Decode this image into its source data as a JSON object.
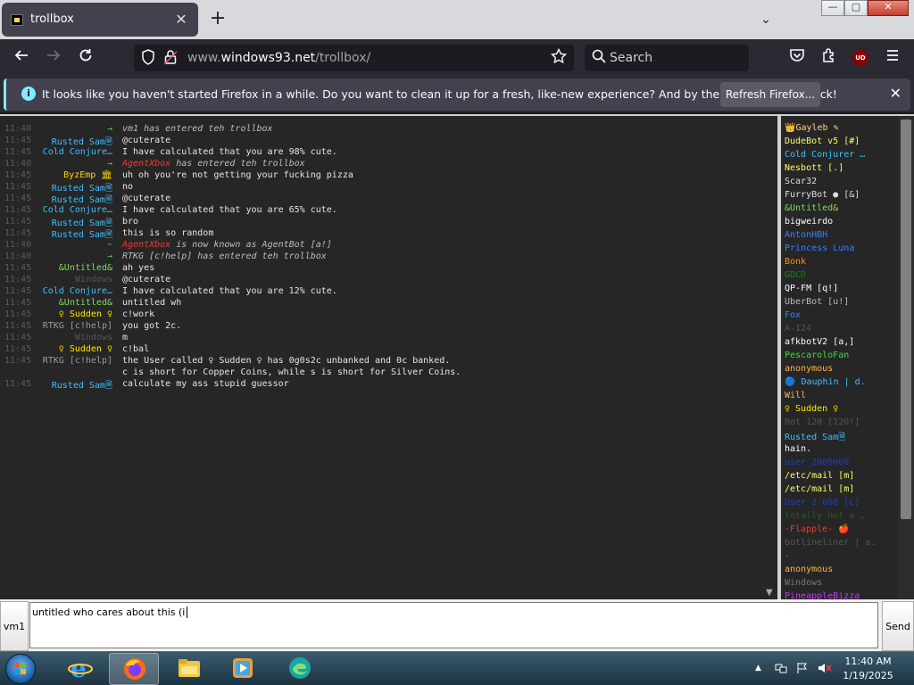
{
  "browser": {
    "tab_title": "trollbox",
    "tab_close": "✕",
    "new_tab": "+",
    "tab_list": "⌄",
    "window_controls": {
      "minimize": "—",
      "maximize": "▢",
      "close": "✕"
    },
    "url_host_prefix": "www.",
    "url_host": "windows93.net",
    "url_path": "/trollbox/",
    "search_placeholder": "Search",
    "ublock_label": "UD",
    "nav_icons": [
      "back-icon",
      "forward-icon",
      "reload-icon",
      "shield-icon",
      "lock-icon",
      "bookmark-star-icon",
      "search-icon",
      "pocket-icon",
      "extensions-icon",
      "menu-icon"
    ]
  },
  "notification": {
    "text": "It looks like you haven't started Firefox in a while. Do you want to clean it up for a fresh, like-new experience? And by the way, welcome back!",
    "button": "Refresh Firefox...",
    "close": "✕",
    "accent": "#80ebff"
  },
  "chat": {
    "messages": [
      {
        "time": "11:40",
        "nick": "→",
        "nick_color": "#3ddc3d",
        "text": "vm1 has entered teh trollbox",
        "text_color": "#bdbdbd",
        "italic": true
      },
      {
        "time": "11:45",
        "nick": "Rusted Sam🗎",
        "nick_color": "#3fbfff",
        "text": "@cuterate",
        "text_color": "#e6e6e6"
      },
      {
        "time": "11:45",
        "nick": "Cold Conjure…",
        "nick_color": "#3fbfff",
        "text": "I have calculated that you are 98% cute.",
        "text_color": "#e6e6e6"
      },
      {
        "time": "11:40",
        "nick": "→",
        "nick_color": "#3ddc3d",
        "text": "AgentXbox has entered teh trollbox",
        "text_color": "#bdbdbd",
        "italic": true,
        "highlight": "AgentXbox",
        "highlight_color": "#ff3333"
      },
      {
        "time": "11:45",
        "nick": "ByzEmp 🏛",
        "nick_color": "#ffd700",
        "text": "uh oh you're not getting your fucking pizza",
        "text_color": "#e6e6e6"
      },
      {
        "time": "11:45",
        "nick": "Rusted Sam🗎",
        "nick_color": "#3fbfff",
        "text": "no",
        "text_color": "#e6e6e6"
      },
      {
        "time": "11:45",
        "nick": "Rusted Sam🗎",
        "nick_color": "#3fbfff",
        "text": "@cuterate",
        "text_color": "#e6e6e6"
      },
      {
        "time": "11:45",
        "nick": "Cold Conjure…",
        "nick_color": "#3fbfff",
        "text": "I have calculated that you are 65% cute.",
        "text_color": "#e6e6e6"
      },
      {
        "time": "11:45",
        "nick": "Rusted Sam🗎",
        "nick_color": "#3fbfff",
        "text": "bro",
        "text_color": "#e6e6e6"
      },
      {
        "time": "11:45",
        "nick": "Rusted Sam🗎",
        "nick_color": "#3fbfff",
        "text": "this is so random",
        "text_color": "#e6e6e6"
      },
      {
        "time": "11:40",
        "nick": "~",
        "nick_color": "#3ddc3d",
        "text": "AgentXbox is now known as AgentBot [a!]",
        "text_color": "#bdbdbd",
        "italic": true,
        "highlight": "AgentXbox",
        "highlight_color": "#ff3333"
      },
      {
        "time": "11:40",
        "nick": "→",
        "nick_color": "#3ddc3d",
        "text": "RTKG [c!help] has entered teh trollbox",
        "text_color": "#bdbdbd",
        "italic": true
      },
      {
        "time": "11:45",
        "nick": "&Untitled&",
        "nick_color": "#7fdc5a",
        "text": "ah yes",
        "text_color": "#e6e6e6"
      },
      {
        "time": "11:45",
        "nick": "Windows",
        "nick_color": "#555555",
        "text": "@cuterate",
        "text_color": "#e6e6e6"
      },
      {
        "time": "11:45",
        "nick": "Cold Conjure…",
        "nick_color": "#3fbfff",
        "text": "I have calculated that you are 12% cute.",
        "text_color": "#e6e6e6"
      },
      {
        "time": "11:45",
        "nick": "&Untitled&",
        "nick_color": "#7fdc5a",
        "text": "untitled wh",
        "text_color": "#e6e6e6"
      },
      {
        "time": "11:45",
        "nick": "♀ Sudden ♀",
        "nick_color": "#ffe600",
        "text": "c!work",
        "text_color": "#e6e6e6"
      },
      {
        "time": "11:45",
        "nick": "RTKG [c!help]",
        "nick_color": "#9a9a9a",
        "text": "you got 2c.",
        "text_color": "#e6e6e6"
      },
      {
        "time": "11:45",
        "nick": "Windows",
        "nick_color": "#555555",
        "text": "m",
        "text_color": "#e6e6e6"
      },
      {
        "time": "11:45",
        "nick": "♀ Sudden ♀",
        "nick_color": "#ffe600",
        "text": "c!bal",
        "text_color": "#e6e6e6"
      },
      {
        "time": "11:45",
        "nick": "RTKG [c!help]",
        "nick_color": "#9a9a9a",
        "text": "the User called ♀ Sudden ♀ has 0g0s2c unbanked and 0c banked.",
        "text_color": "#e6e6e6"
      },
      {
        "time": "",
        "nick": "",
        "nick_color": "#9a9a9a",
        "text": "c is short for Copper Coins, while s is short for Silver Coins.",
        "text_color": "#e6e6e6"
      },
      {
        "time": "11:45",
        "nick": "Rusted Sam🗎",
        "nick_color": "#3fbfff",
        "text": "calculate my ass stupid guessor",
        "text_color": "#e6e6e6"
      }
    ],
    "time_color": "#5a5a5a"
  },
  "users": [
    {
      "name": "👑Gayleb ✎",
      "color": "#ffd27f"
    },
    {
      "name": "DudeBot v5 [#]",
      "color": "#ffff66"
    },
    {
      "name": "Cold Conjurer …",
      "color": "#3fbfff"
    },
    {
      "name": "Nesbott [.]",
      "color": "#ffff66"
    },
    {
      "name": "Scar32",
      "color": "#dddddd"
    },
    {
      "name": "FurryBot ● [&]",
      "color": "#dddddd"
    },
    {
      "name": "&Untitled&",
      "color": "#7fdc5a"
    },
    {
      "name": "bigweirdo",
      "color": "#ffffff"
    },
    {
      "name": "AntonHBH",
      "color": "#3a7fff"
    },
    {
      "name": "Princess Luna",
      "color": "#3a7fff"
    },
    {
      "name": "Bonk",
      "color": "#ff8c1a"
    },
    {
      "name": "GDCD",
      "color": "#1f7a1f"
    },
    {
      "name": "QP-FM [q!]",
      "color": "#ffffff"
    },
    {
      "name": "UberBot [u!]",
      "color": "#bbbbbb"
    },
    {
      "name": "Fox",
      "color": "#3a7fff"
    },
    {
      "name": "A-124",
      "color": "#555555"
    },
    {
      "name": "afkbotV2 [a,]",
      "color": "#ffffff"
    },
    {
      "name": "PescaroloFan",
      "color": "#3ddc3d"
    },
    {
      "name": "anonymous",
      "color": "#ffb347"
    },
    {
      "name": "🔵 Dauphin | d.",
      "color": "#3fbfff"
    },
    {
      "name": "Will",
      "color": "#ffb347"
    },
    {
      "name": "♀ Sudden ♀",
      "color": "#ffe600"
    },
    {
      "name": "Bot 120 [120!]",
      "color": "#555555"
    },
    {
      "name": "Rusted Sam🗎",
      "color": "#3fbfff"
    },
    {
      "name": "hain.",
      "color": "#ffffff"
    },
    {
      "name": "user_2000000",
      "color": "#1f3fbf"
    },
    {
      "name": "/etc/mail [m]",
      "color": "#ffff66"
    },
    {
      "name": "/etc/mail [m]",
      "color": "#ffff66"
    },
    {
      "name": "User 2.000 [c]",
      "color": "#1f3fbf"
    },
    {
      "name": "totally not a …",
      "color": "#1f5f1f"
    },
    {
      "name": "-Flapple- 🍎",
      "color": "#ff3333"
    },
    {
      "name": "botlineliner | a.",
      "color": "#555555"
    },
    {
      "name": "-",
      "color": "#ff3333"
    },
    {
      "name": "anonymous",
      "color": "#ffb347"
    },
    {
      "name": "Windows",
      "color": "#777777"
    },
    {
      "name": "PineappleBizza",
      "color": "#cc33ff"
    }
  ],
  "input": {
    "nick_label": "vm1",
    "value": "untitled who cares about this (i",
    "send_label": "Send"
  },
  "taskbar": {
    "items": [
      "internet-explorer-icon",
      "firefox-icon",
      "file-explorer-icon",
      "media-player-icon",
      "edge-icon"
    ],
    "active_index": 1,
    "time": "11:40 AM",
    "date": "1/19/2025",
    "tray_show_hidden": "▲"
  }
}
